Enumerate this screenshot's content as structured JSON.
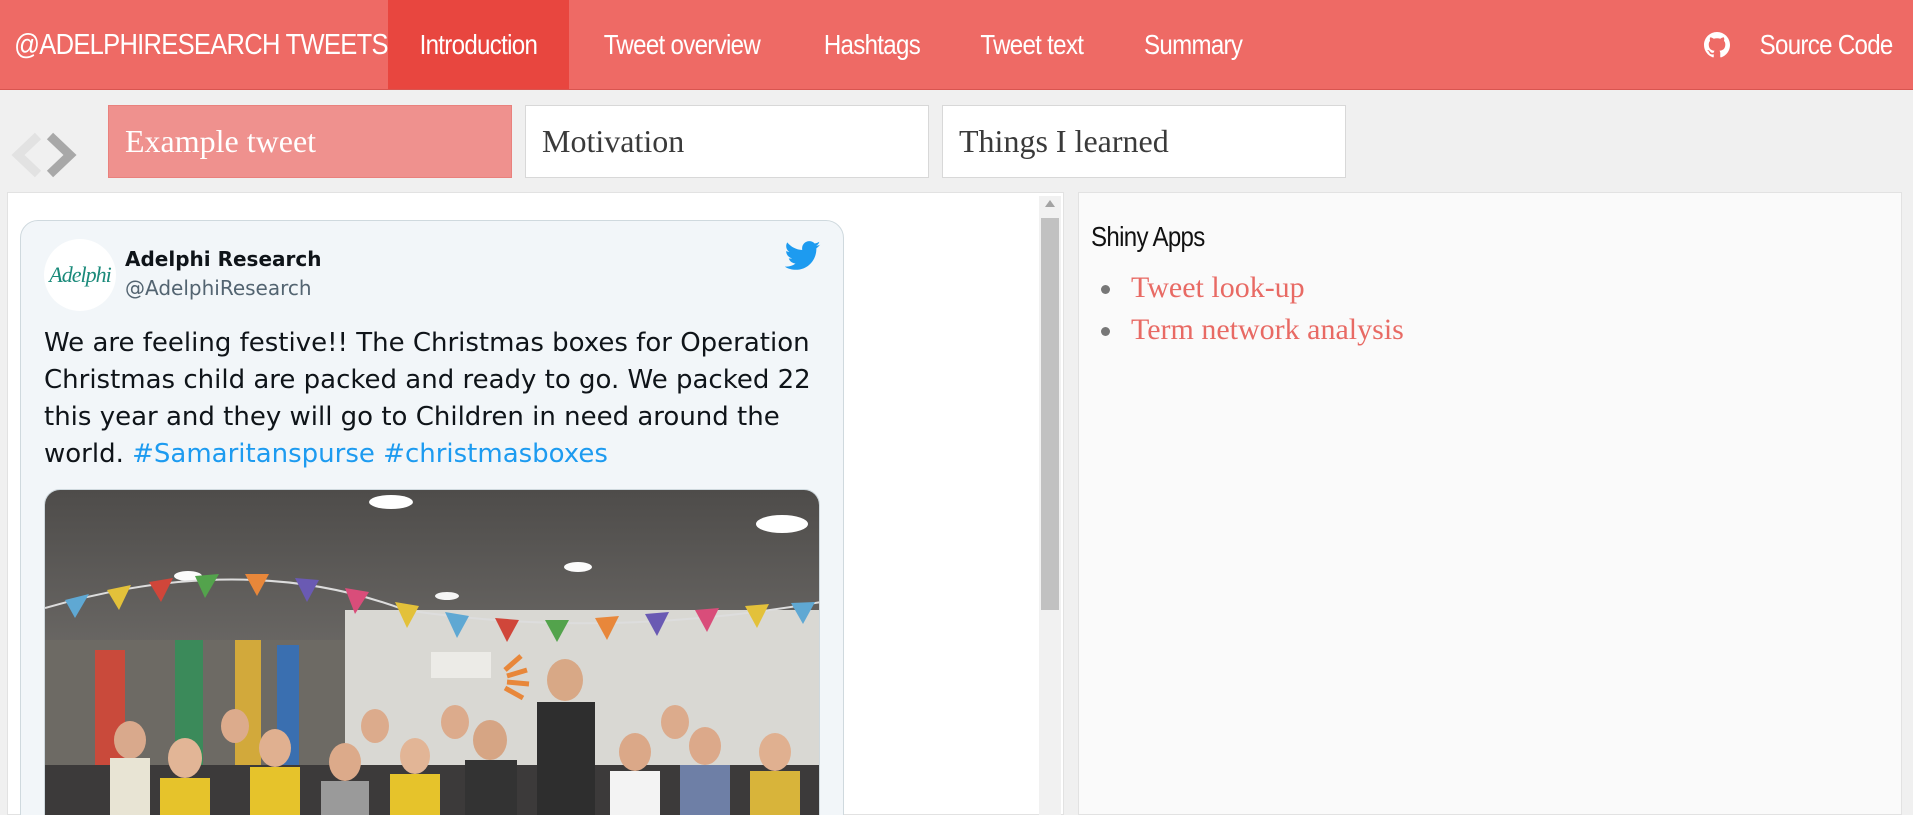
{
  "navbar": {
    "brand": "@ADELPHIRESEARCH TWEETS",
    "items": [
      {
        "label": "Introduction",
        "active": true
      },
      {
        "label": "Tweet overview",
        "active": false
      },
      {
        "label": "Hashtags",
        "active": false
      },
      {
        "label": "Tweet text",
        "active": false
      },
      {
        "label": "Summary",
        "active": false
      }
    ],
    "source_code_label": "Source Code",
    "source_code_icon": "github-icon",
    "colors": {
      "bar": "#ee6a65",
      "active": "#e8463f"
    }
  },
  "carousel": {
    "tabs": [
      {
        "label": "Example tweet",
        "active": true
      },
      {
        "label": "Motivation",
        "active": false
      },
      {
        "label": "Things I learned",
        "active": false
      }
    ],
    "prev_icon": "chevron-left-icon",
    "next_icon": "chevron-right-icon"
  },
  "tweet": {
    "author_name": "Adelphi Research",
    "author_handle": "@AdelphiResearch",
    "avatar_text": "Adelphi",
    "text": "We are feeling festive!! The Christmas boxes for Operation Christmas child are packed and ready to go. We packed 22 this year and they will go to Children in need around the world. ",
    "hashtags": [
      "#Samaritanspurse",
      "#christmasboxes"
    ],
    "logo_icon": "twitter-bird-icon",
    "link_color": "#1d9bf0"
  },
  "right_panel": {
    "title": "Shiny Apps",
    "links": [
      "Tweet look-up",
      "Term network analysis"
    ],
    "link_color": "#e86a64"
  }
}
